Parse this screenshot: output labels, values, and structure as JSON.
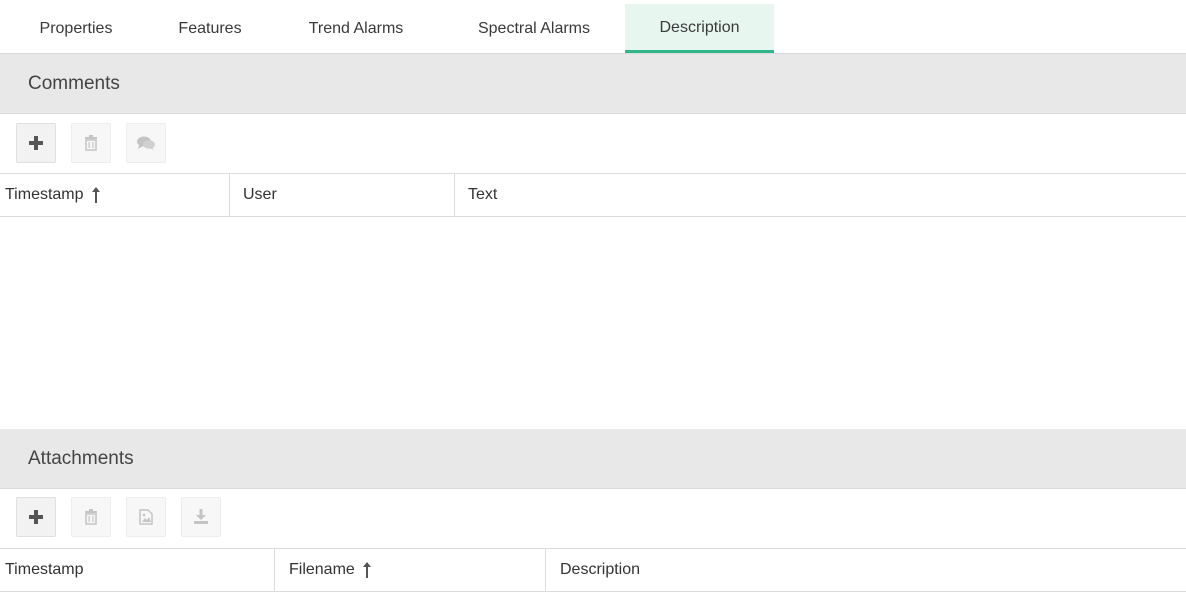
{
  "tabs": [
    {
      "label": "Properties"
    },
    {
      "label": "Features"
    },
    {
      "label": "Trend Alarms"
    },
    {
      "label": "Spectral Alarms"
    },
    {
      "label": "Description",
      "active": true
    }
  ],
  "comments": {
    "title": "Comments",
    "toolbar": [
      "add-icon",
      "trash-icon",
      "comment-icon"
    ],
    "columns": {
      "timestamp": "Timestamp",
      "user": "User",
      "text": "Text"
    },
    "sorted_column": "timestamp",
    "rows": []
  },
  "attachments": {
    "title": "Attachments",
    "toolbar": [
      "add-icon",
      "trash-icon",
      "image-icon",
      "download-icon"
    ],
    "columns": {
      "timestamp": "Timestamp",
      "filename": "Filename",
      "description": "Description"
    },
    "sorted_column": "filename",
    "rows": []
  },
  "colors": {
    "active_tab_bg": "#e8f6f0",
    "active_tab_accent": "#2fb68a",
    "section_header_bg": "#e8e8e8"
  }
}
